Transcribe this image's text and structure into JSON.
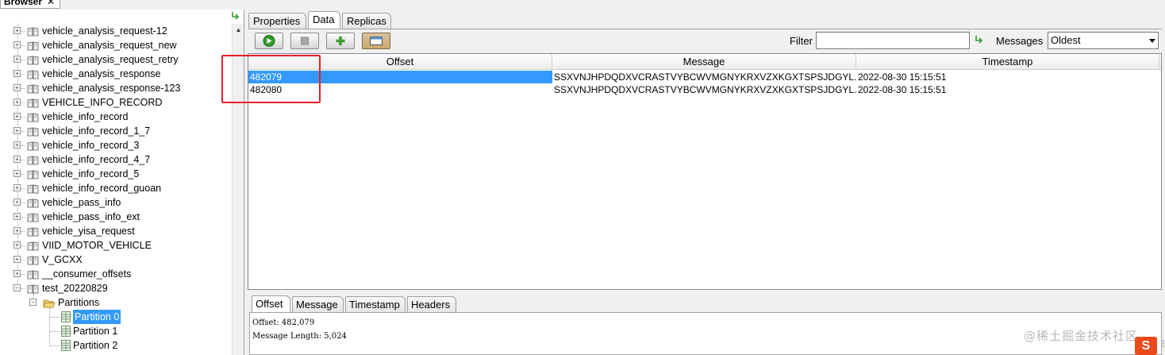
{
  "browser": {
    "tab_label": "Browser",
    "close_glyph": "✕",
    "tree": [
      {
        "label": "vehicle_analysis_request-12",
        "type": "topic"
      },
      {
        "label": "vehicle_analysis_request_new",
        "type": "topic"
      },
      {
        "label": "vehicle_analysis_request_retry",
        "type": "topic"
      },
      {
        "label": "vehicle_analysis_response",
        "type": "topic"
      },
      {
        "label": "vehicle_analysis_response-123",
        "type": "topic"
      },
      {
        "label": "VEHICLE_INFO_RECORD",
        "type": "topic"
      },
      {
        "label": "vehicle_info_record",
        "type": "topic"
      },
      {
        "label": "vehicle_info_record_1_7",
        "type": "topic"
      },
      {
        "label": "vehicle_info_record_3",
        "type": "topic"
      },
      {
        "label": "vehicle_info_record_4_7",
        "type": "topic"
      },
      {
        "label": "vehicle_info_record_5",
        "type": "topic"
      },
      {
        "label": "vehicle_info_record_guoan",
        "type": "topic"
      },
      {
        "label": "vehicle_pass_info",
        "type": "topic"
      },
      {
        "label": "vehicle_pass_info_ext",
        "type": "topic"
      },
      {
        "label": "vehicle_yisa_request",
        "type": "topic"
      },
      {
        "label": "VIID_MOTOR_VEHICLE",
        "type": "topic"
      },
      {
        "label": "V_GCXX",
        "type": "topic"
      },
      {
        "label": "__consumer_offsets",
        "type": "topic"
      },
      {
        "label": "test_20220829",
        "type": "topic-expanded"
      },
      {
        "label": "Partitions",
        "type": "folder"
      },
      {
        "label": "Partition 0",
        "type": "partition",
        "selected": true
      },
      {
        "label": "Partition 1",
        "type": "partition"
      },
      {
        "label": "Partition 2",
        "type": "partition"
      }
    ]
  },
  "tabs": {
    "properties": "Properties",
    "data": "Data",
    "replicas": "Replicas"
  },
  "toolbar": {
    "filter_label": "Filter",
    "filter_value": "",
    "messages_label": "Messages",
    "messages_selected": "Oldest"
  },
  "table": {
    "columns": [
      "Offset",
      "Message",
      "Timestamp"
    ],
    "rows": [
      {
        "offset": "482079",
        "message": "SSXVNJHPDQDXVCRASTVYBCWVMGNYKRXVZXKGXTSPSJDGYL...",
        "timestamp": "2022-08-30 15:15:51",
        "selected": true
      },
      {
        "offset": "482080",
        "message": "SSXVNJHPDQDXVCRASTVYBCWVMGNYKRXVZXKGXTSPSJDGYL...",
        "timestamp": "2022-08-30 15:15:51",
        "selected": false
      }
    ]
  },
  "detail": {
    "tabs": [
      "Offset",
      "Message",
      "Timestamp",
      "Headers"
    ],
    "lines": [
      "Offset: 482,079",
      "Message Length: 5,024"
    ]
  },
  "overlay": {
    "watermark": "@稀土掘金技术社区",
    "ime_badge": "S",
    "ime_dots": "⋮"
  },
  "colors": {
    "selection": "#3399ff",
    "highlight": "#e8202a",
    "play_green": "#2e9b2e"
  }
}
